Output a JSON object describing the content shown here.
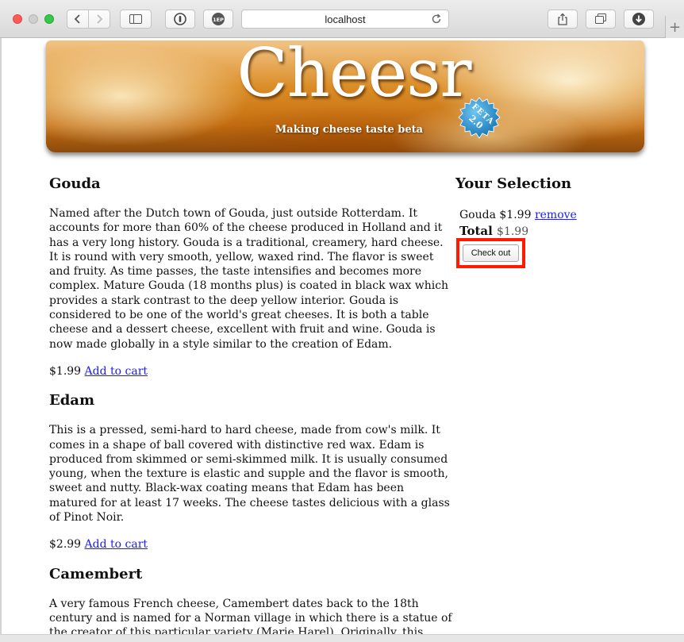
{
  "browser": {
    "url": "localhost",
    "icons": {
      "back": "chevron-left-icon",
      "forward": "chevron-right-icon",
      "sidebar": "sidebar-icon",
      "privacy": "privacy-icon",
      "extension": "extension-icon",
      "reload": "reload-icon",
      "share": "share-icon",
      "tabs": "tabs-icon",
      "download": "download-icon",
      "new_tab": "plus-icon"
    },
    "extension_label": "1EP",
    "new_tab_label": "+"
  },
  "banner": {
    "title": "Cheesr",
    "tagline": "Making cheese taste beta",
    "badge_line1": "FETA",
    "badge_line2": "2.0"
  },
  "cheeses": [
    {
      "name": "Gouda",
      "description": "Named after the Dutch town of Gouda, just outside Rotterdam. It accounts for more than 60% of the cheese produced in Holland and it has a very long history. Gouda is a traditional, creamery, hard cheese. It is round with very smooth, yellow, waxed rind. The flavor is sweet and fruity. As time passes, the taste intensifies and becomes more complex. Mature Gouda (18 months plus) is coated in black wax which provides a stark contrast to the deep yellow interior. Gouda is considered to be one of the world's great cheeses. It is both a table cheese and a dessert cheese, excellent with fruit and wine. Gouda is now made globally in a style similar to the creation of Edam.",
      "price": "$1.99",
      "add_label": "Add to cart"
    },
    {
      "name": "Edam",
      "description": "This is a pressed, semi-hard to hard cheese, made from cow's milk. It comes in a shape of ball covered with distinctive red wax. Edam is produced from skimmed or semi-skimmed milk. It is usually consumed young, when the texture is elastic and supple and the flavor is smooth, sweet and nutty. Black-wax coating means that Edam has been matured for at least 17 weeks. The cheese tastes delicious with a glass of Pinot Noir.",
      "price": "$2.99",
      "add_label": "Add to cart"
    },
    {
      "name": "Camembert",
      "description": "A very famous French cheese, Camembert dates back to the 18th century and is named for a Norman village in which there is a statue of the creator of this particular variety (Marie Harel). Originally, this"
    }
  ],
  "selection": {
    "heading": "Your Selection",
    "item_name": "Gouda",
    "item_price": "$1.99",
    "remove_label": "remove",
    "total_label": "Total",
    "total_value": "$1.99",
    "checkout_label": "Check out",
    "highlight_color": "#ff1a00"
  },
  "colors": {
    "link": "#2020ee",
    "banner_orange": "#d98a23"
  }
}
